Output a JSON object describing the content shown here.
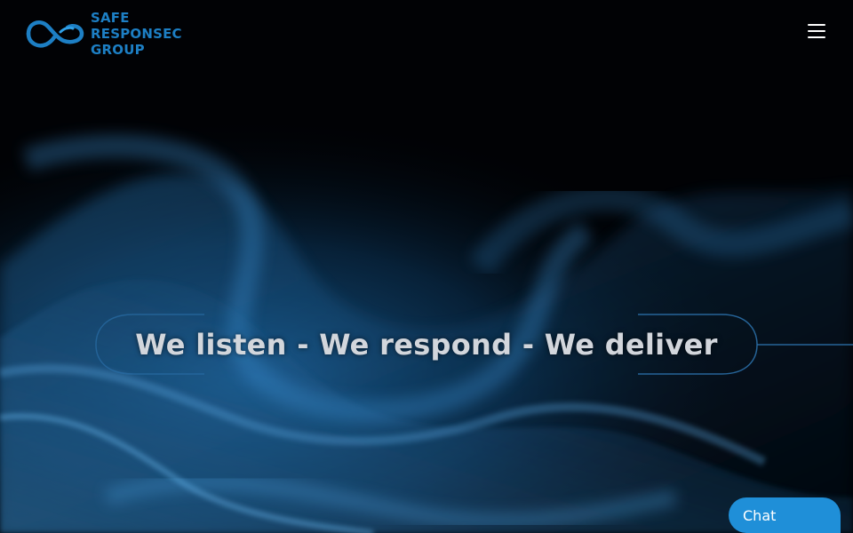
{
  "header": {
    "logo": {
      "line1": "SAFE",
      "line2": "RESPONSEC",
      "line3": "GROUP",
      "icon": "infinity-logo-icon"
    },
    "menu_icon": "hamburger-menu-icon"
  },
  "hero": {
    "tagline": "We listen - We respond - We deliver"
  },
  "chat": {
    "label": "Chat"
  },
  "colors": {
    "brand_blue": "#1d7fc4",
    "chat_blue": "#1f8fd8",
    "background": "#000000",
    "tagline_text": "#d2d6dc"
  }
}
